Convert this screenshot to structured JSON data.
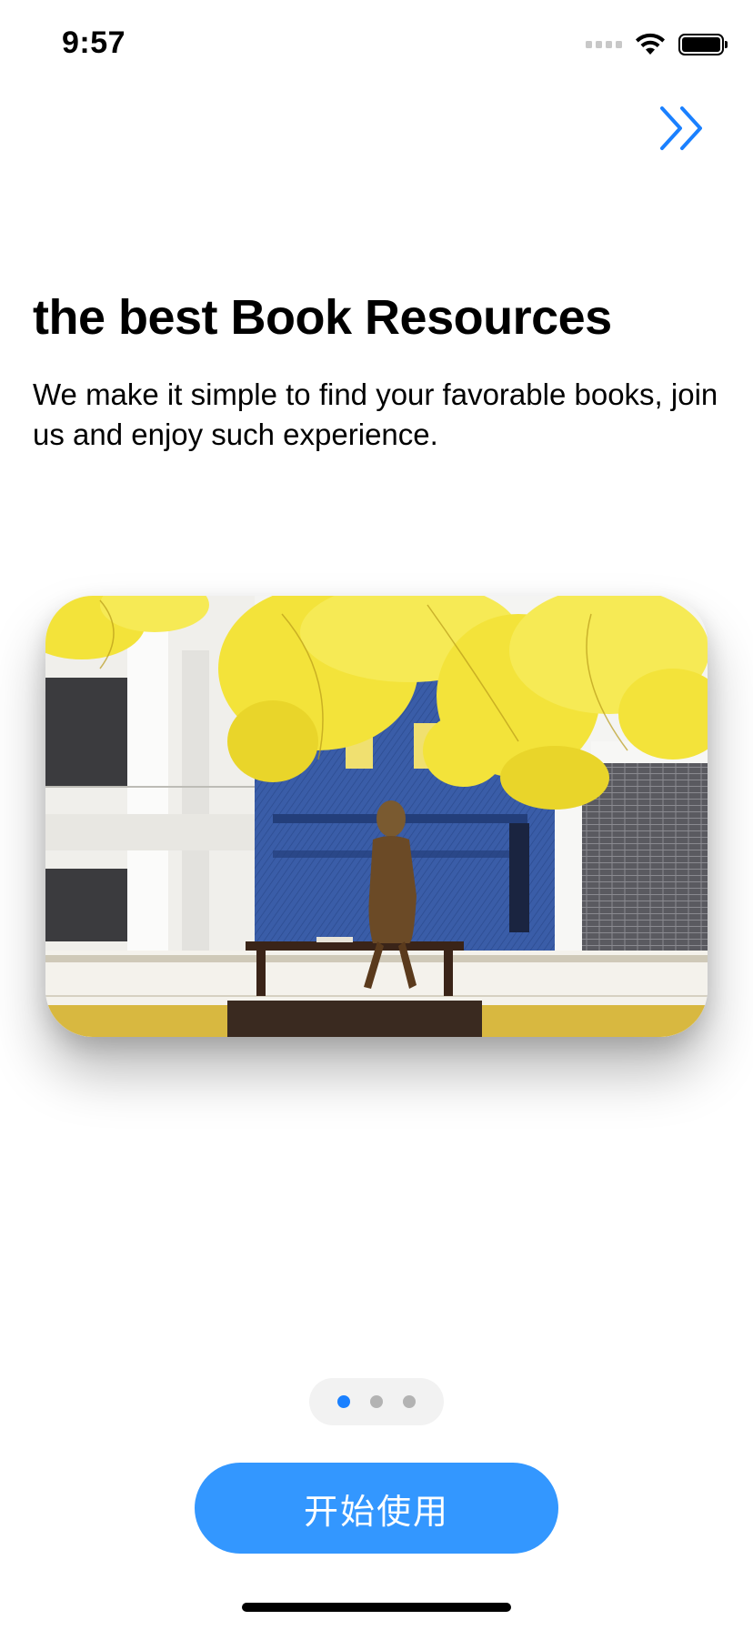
{
  "status_bar": {
    "time": "9:57"
  },
  "onboarding": {
    "headline": "the best Book Resources",
    "subtitle": "We make it simple to find your favorable books, join us and enjoy such experience.",
    "pages_total": 3,
    "current_page": 1
  },
  "start_button": {
    "label": "开始使用"
  },
  "icons": {
    "skip": "double-chevron-right-icon",
    "wifi": "wifi-icon",
    "battery": "battery-icon",
    "signal": "cellular-signal-icon"
  },
  "colors": {
    "accent": "#1a80ff",
    "button": "#3397ff",
    "dot_inactive": "#b3b3b3",
    "pager_bg": "#f2f2f2"
  }
}
